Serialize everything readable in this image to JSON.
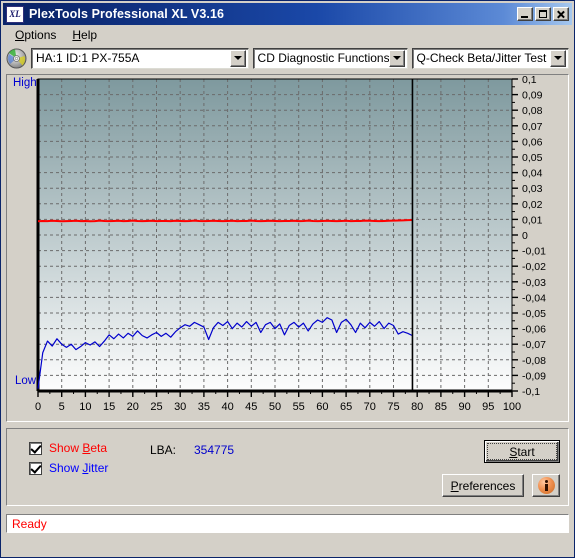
{
  "window": {
    "title": "PlexTools Professional XL V3.16",
    "icon": "XL",
    "buttons": {
      "minimize": "minimize-icon",
      "maximize": "maximize-icon",
      "close": "close-icon"
    }
  },
  "menubar": {
    "items": [
      {
        "label": "Options",
        "accel": "O"
      },
      {
        "label": "Help",
        "accel": "H"
      }
    ]
  },
  "toolbar": {
    "disc_icon": "cd-disc-icon",
    "drive_combo": {
      "value": "HA:1 ID:1  PX-755A"
    },
    "function_combo": {
      "value": "CD Diagnostic Functions"
    },
    "test_combo": {
      "value": "Q-Check Beta/Jitter Test"
    }
  },
  "chart_labels": {
    "high": "High",
    "low": "Low"
  },
  "controls": {
    "show_beta": {
      "label": "Show Beta",
      "accel": "B",
      "checked": true,
      "color": "#ff0000"
    },
    "show_jitter": {
      "label": "Show Jitter",
      "accel": "J",
      "checked": true,
      "color": "#0000ff"
    },
    "lba_label": "LBA:",
    "lba_value": "354775",
    "start_button": {
      "label": "Start",
      "accel": "S"
    },
    "preferences_button": {
      "label": "Preferences",
      "accel": "P"
    },
    "info_button": {
      "label": "info-icon"
    }
  },
  "statusbar": {
    "text": "Ready"
  },
  "chart_data": {
    "type": "line",
    "title": "Q-Check Beta/Jitter Test",
    "xlabel": "",
    "ylabel": "",
    "xlim": [
      0,
      100
    ],
    "ylim": [
      -0.1,
      0.1
    ],
    "grid": true,
    "legend": "none",
    "y_tick_labels": [
      "0,1",
      "0,09",
      "0,08",
      "0,07",
      "0,06",
      "0,05",
      "0,04",
      "0,03",
      "0,02",
      "0,01",
      "0",
      "-0,01",
      "-0,02",
      "-0,03",
      "-0,04",
      "-0,05",
      "-0,06",
      "-0,07",
      "-0,08",
      "-0,09",
      "-0,1"
    ],
    "y_tick_values": [
      0.1,
      0.09,
      0.08,
      0.07,
      0.06,
      0.05,
      0.04,
      0.03,
      0.02,
      0.01,
      0,
      -0.01,
      -0.02,
      -0.03,
      -0.04,
      -0.05,
      -0.06,
      -0.07,
      -0.08,
      -0.09,
      -0.1
    ],
    "x_tick_labels": [
      "0",
      "5",
      "10",
      "15",
      "20",
      "25",
      "30",
      "35",
      "40",
      "45",
      "50",
      "55",
      "60",
      "65",
      "70",
      "75",
      "80",
      "85",
      "90",
      "95",
      "100"
    ],
    "x_tick_values": [
      0,
      5,
      10,
      15,
      20,
      25,
      30,
      35,
      40,
      45,
      50,
      55,
      60,
      65,
      70,
      75,
      80,
      85,
      90,
      95,
      100
    ],
    "marker_line_x": 79,
    "background_gradient": [
      "#7e999e",
      "#fdfdfd"
    ],
    "series": [
      {
        "name": "Beta",
        "color": "#ff0000",
        "x": [
          0,
          1,
          2,
          3,
          4,
          5,
          6,
          7,
          8,
          9,
          10,
          11,
          12,
          13,
          14,
          15,
          16,
          17,
          18,
          19,
          20,
          21,
          22,
          23,
          24,
          25,
          26,
          27,
          28,
          29,
          30,
          31,
          32,
          33,
          34,
          35,
          36,
          37,
          38,
          39,
          40,
          41,
          42,
          43,
          44,
          45,
          46,
          47,
          48,
          49,
          50,
          51,
          52,
          53,
          54,
          55,
          56,
          57,
          58,
          59,
          60,
          61,
          62,
          63,
          64,
          65,
          66,
          67,
          68,
          69,
          70,
          71,
          72,
          73,
          74,
          75,
          76,
          77,
          78,
          79
        ],
        "values": [
          0.0088,
          0.009,
          0.0089,
          0.0091,
          0.009,
          0.0088,
          0.0089,
          0.009,
          0.0091,
          0.0089,
          0.009,
          0.0088,
          0.0089,
          0.0092,
          0.009,
          0.0089,
          0.009,
          0.0091,
          0.0089,
          0.009,
          0.0092,
          0.009,
          0.0089,
          0.009,
          0.0091,
          0.0089,
          0.009,
          0.009,
          0.0089,
          0.0091,
          0.009,
          0.0089,
          0.009,
          0.0092,
          0.009,
          0.0089,
          0.009,
          0.0091,
          0.009,
          0.0089,
          0.009,
          0.0091,
          0.0089,
          0.009,
          0.009,
          0.0092,
          0.009,
          0.0089,
          0.009,
          0.0091,
          0.009,
          0.0089,
          0.009,
          0.009,
          0.0091,
          0.0089,
          0.009,
          0.0092,
          0.009,
          0.0089,
          0.009,
          0.0091,
          0.009,
          0.0089,
          0.009,
          0.0091,
          0.0089,
          0.009,
          0.009,
          0.0092,
          0.0091,
          0.009,
          0.0089,
          0.009,
          0.0091,
          0.0092,
          0.0093,
          0.0094,
          0.0095,
          0.0096
        ]
      },
      {
        "name": "Jitter",
        "color": "#0000cc",
        "x": [
          0,
          1,
          2,
          3,
          4,
          5,
          6,
          7,
          8,
          9,
          10,
          11,
          12,
          13,
          14,
          15,
          16,
          17,
          18,
          19,
          20,
          21,
          22,
          23,
          24,
          25,
          26,
          27,
          28,
          29,
          30,
          31,
          32,
          33,
          34,
          35,
          36,
          37,
          38,
          39,
          40,
          41,
          42,
          43,
          44,
          45,
          46,
          47,
          48,
          49,
          50,
          51,
          52,
          53,
          54,
          55,
          56,
          57,
          58,
          59,
          60,
          61,
          62,
          63,
          64,
          65,
          66,
          67,
          68,
          69,
          70,
          71,
          72,
          73,
          74,
          75,
          76,
          77,
          78,
          79
        ],
        "values": [
          -0.0985,
          -0.0755,
          -0.068,
          -0.0712,
          -0.0665,
          -0.07,
          -0.072,
          -0.07,
          -0.0735,
          -0.0715,
          -0.069,
          -0.0705,
          -0.0685,
          -0.0715,
          -0.068,
          -0.064,
          -0.0665,
          -0.0635,
          -0.066,
          -0.063,
          -0.065,
          -0.0615,
          -0.0645,
          -0.066,
          -0.064,
          -0.0625,
          -0.065,
          -0.063,
          -0.0655,
          -0.062,
          -0.0595,
          -0.0575,
          -0.0585,
          -0.056,
          -0.0575,
          -0.059,
          -0.067,
          -0.0595,
          -0.056,
          -0.058,
          -0.0555,
          -0.06,
          -0.0565,
          -0.059,
          -0.0555,
          -0.0585,
          -0.056,
          -0.0625,
          -0.0575,
          -0.056,
          -0.06,
          -0.057,
          -0.064,
          -0.058,
          -0.056,
          -0.059,
          -0.0565,
          -0.0615,
          -0.057,
          -0.0545,
          -0.056,
          -0.053,
          -0.0545,
          -0.0625,
          -0.056,
          -0.054,
          -0.0575,
          -0.0625,
          -0.0565,
          -0.0595,
          -0.056,
          -0.0585,
          -0.0555,
          -0.06,
          -0.0565,
          -0.058,
          -0.0635,
          -0.062,
          -0.063,
          -0.0645
        ]
      }
    ]
  }
}
